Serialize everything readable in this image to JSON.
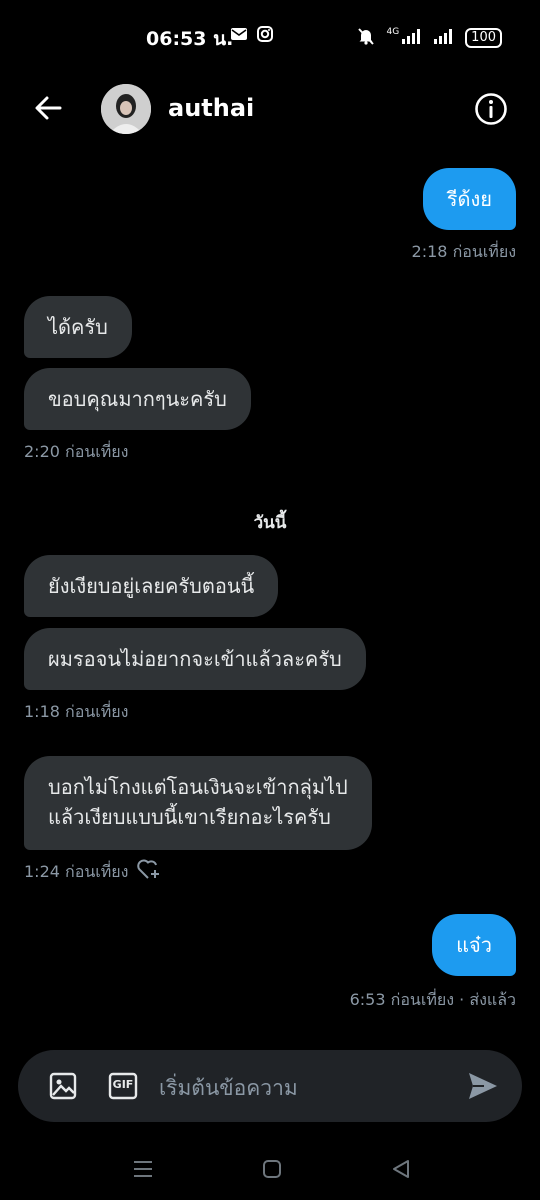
{
  "status_bar": {
    "time": "06:53 น.",
    "network_label": "4G",
    "battery": "100"
  },
  "header": {
    "username": "authai"
  },
  "messages": [
    {
      "text": "รีด้งย",
      "direction": "out"
    },
    {
      "text": "ได้ครับ",
      "direction": "in"
    },
    {
      "text": "ขอบคุณมากๆนะครับ",
      "direction": "in"
    },
    {
      "text": "ยังเงียบอยู่เลยครับตอนนี้",
      "direction": "in"
    },
    {
      "text": "ผมรอจนไม่อยากจะเข้าแล้วละครับ",
      "direction": "in"
    },
    {
      "text_line1": "บอกไม่โกงแต่โอนเงินจะเข้ากลุ่มไป",
      "text_line2": "แล้วเงียบแบบนี้เขาเรียกอะไรครับ",
      "direction": "in"
    },
    {
      "text": "แจ๋ว",
      "direction": "out"
    }
  ],
  "timestamps": {
    "t1": "2:18 ก่อนเที่ยง",
    "t2": "2:20 ก่อนเที่ยง",
    "t3": "1:18 ก่อนเที่ยง",
    "t4": "1:24 ก่อนเที่ยง",
    "t5": "6:53 ก่อนเที่ยง · ส่งแล้ว"
  },
  "day_divider": "วันนี้",
  "composer": {
    "placeholder": "เริ่มต้นข้อความ",
    "gif_label": "GIF"
  },
  "colors": {
    "background": "#000000",
    "incoming_bubble": "#2f3336",
    "outgoing_bubble": "#1d9bf0",
    "secondary_text": "#8b98a5"
  }
}
